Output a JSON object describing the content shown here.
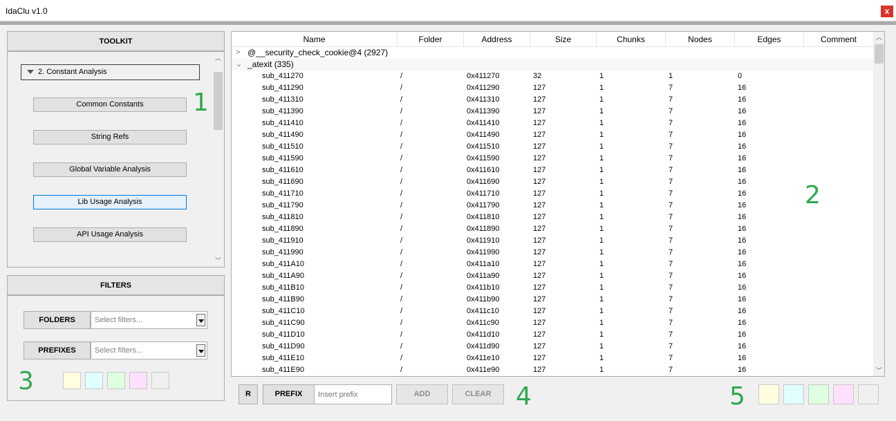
{
  "window": {
    "title": "IdaClu v1.0",
    "close_label": "x"
  },
  "toolkit": {
    "header": "TOOLKIT",
    "category": "2. Constant Analysis",
    "buttons": [
      {
        "label": "Common Constants",
        "active": false
      },
      {
        "label": "String Refs",
        "active": false
      },
      {
        "label": "Global Variable Analysis",
        "active": false
      },
      {
        "label": "Lib Usage Analysis",
        "active": true
      },
      {
        "label": "API Usage Analysis",
        "active": false
      }
    ]
  },
  "filters": {
    "header": "FILTERS",
    "folders_label": "FOLDERS",
    "folders_placeholder": "Select filters...",
    "prefixes_label": "PREFIXES",
    "prefixes_placeholder": "Select filters..."
  },
  "swatch_colors": [
    "#ffffe0",
    "#e0ffff",
    "#e0ffe0",
    "#ffe0ff",
    "#f0f0f0"
  ],
  "annotations": [
    "1",
    "2",
    "3",
    "4",
    "5"
  ],
  "table": {
    "columns": [
      "Name",
      "Folder",
      "Address",
      "Size",
      "Chunks",
      "Nodes",
      "Edges",
      "Comment"
    ],
    "groups": [
      {
        "name": "@__security_check_cookie@4 (2927)",
        "expanded": false
      },
      {
        "name": "_atexit (335)",
        "expanded": true
      }
    ],
    "rows": [
      {
        "name": "sub_411270",
        "folder": "/",
        "address": "0x411270",
        "size": "32",
        "chunks": "1",
        "nodes": "1",
        "edges": "0"
      },
      {
        "name": "sub_411290",
        "folder": "/",
        "address": "0x411290",
        "size": "127",
        "chunks": "1",
        "nodes": "7",
        "edges": "16"
      },
      {
        "name": "sub_411310",
        "folder": "/",
        "address": "0x411310",
        "size": "127",
        "chunks": "1",
        "nodes": "7",
        "edges": "16"
      },
      {
        "name": "sub_411390",
        "folder": "/",
        "address": "0x411390",
        "size": "127",
        "chunks": "1",
        "nodes": "7",
        "edges": "16"
      },
      {
        "name": "sub_411410",
        "folder": "/",
        "address": "0x411410",
        "size": "127",
        "chunks": "1",
        "nodes": "7",
        "edges": "16"
      },
      {
        "name": "sub_411490",
        "folder": "/",
        "address": "0x411490",
        "size": "127",
        "chunks": "1",
        "nodes": "7",
        "edges": "16"
      },
      {
        "name": "sub_411510",
        "folder": "/",
        "address": "0x411510",
        "size": "127",
        "chunks": "1",
        "nodes": "7",
        "edges": "16"
      },
      {
        "name": "sub_411590",
        "folder": "/",
        "address": "0x411590",
        "size": "127",
        "chunks": "1",
        "nodes": "7",
        "edges": "16"
      },
      {
        "name": "sub_411610",
        "folder": "/",
        "address": "0x411610",
        "size": "127",
        "chunks": "1",
        "nodes": "7",
        "edges": "16"
      },
      {
        "name": "sub_411690",
        "folder": "/",
        "address": "0x411690",
        "size": "127",
        "chunks": "1",
        "nodes": "7",
        "edges": "16"
      },
      {
        "name": "sub_411710",
        "folder": "/",
        "address": "0x411710",
        "size": "127",
        "chunks": "1",
        "nodes": "7",
        "edges": "16"
      },
      {
        "name": "sub_411790",
        "folder": "/",
        "address": "0x411790",
        "size": "127",
        "chunks": "1",
        "nodes": "7",
        "edges": "16"
      },
      {
        "name": "sub_411810",
        "folder": "/",
        "address": "0x411810",
        "size": "127",
        "chunks": "1",
        "nodes": "7",
        "edges": "16"
      },
      {
        "name": "sub_411890",
        "folder": "/",
        "address": "0x411890",
        "size": "127",
        "chunks": "1",
        "nodes": "7",
        "edges": "16"
      },
      {
        "name": "sub_411910",
        "folder": "/",
        "address": "0x411910",
        "size": "127",
        "chunks": "1",
        "nodes": "7",
        "edges": "16"
      },
      {
        "name": "sub_411990",
        "folder": "/",
        "address": "0x411990",
        "size": "127",
        "chunks": "1",
        "nodes": "7",
        "edges": "16"
      },
      {
        "name": "sub_411A10",
        "folder": "/",
        "address": "0x411a10",
        "size": "127",
        "chunks": "1",
        "nodes": "7",
        "edges": "16"
      },
      {
        "name": "sub_411A90",
        "folder": "/",
        "address": "0x411a90",
        "size": "127",
        "chunks": "1",
        "nodes": "7",
        "edges": "16"
      },
      {
        "name": "sub_411B10",
        "folder": "/",
        "address": "0x411b10",
        "size": "127",
        "chunks": "1",
        "nodes": "7",
        "edges": "16"
      },
      {
        "name": "sub_411B90",
        "folder": "/",
        "address": "0x411b90",
        "size": "127",
        "chunks": "1",
        "nodes": "7",
        "edges": "16"
      },
      {
        "name": "sub_411C10",
        "folder": "/",
        "address": "0x411c10",
        "size": "127",
        "chunks": "1",
        "nodes": "7",
        "edges": "16"
      },
      {
        "name": "sub_411C90",
        "folder": "/",
        "address": "0x411c90",
        "size": "127",
        "chunks": "1",
        "nodes": "7",
        "edges": "16"
      },
      {
        "name": "sub_411D10",
        "folder": "/",
        "address": "0x411d10",
        "size": "127",
        "chunks": "1",
        "nodes": "7",
        "edges": "16"
      },
      {
        "name": "sub_411D90",
        "folder": "/",
        "address": "0x411d90",
        "size": "127",
        "chunks": "1",
        "nodes": "7",
        "edges": "16"
      },
      {
        "name": "sub_411E10",
        "folder": "/",
        "address": "0x411e10",
        "size": "127",
        "chunks": "1",
        "nodes": "7",
        "edges": "16"
      },
      {
        "name": "sub_411E90",
        "folder": "/",
        "address": "0x411e90",
        "size": "127",
        "chunks": "1",
        "nodes": "7",
        "edges": "16"
      }
    ]
  },
  "bottom_bar": {
    "r_label": "R",
    "prefix_label": "PREFIX",
    "prefix_placeholder": "Insert prefix",
    "add_label": "ADD",
    "clear_label": "CLEAR"
  }
}
